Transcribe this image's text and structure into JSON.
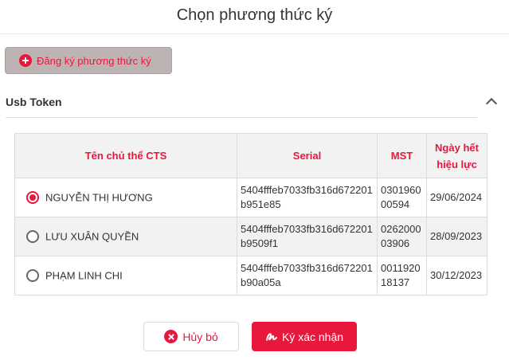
{
  "dialog": {
    "title": "Chọn phương thức ký"
  },
  "register_button": {
    "label": "Đăng ký phương thức ký",
    "icon": "plus-circle-icon"
  },
  "section": {
    "title": "Usb Token",
    "toggle_icon": "chevron-up-icon"
  },
  "table": {
    "headers": [
      "Tên chủ thể CTS",
      "Serial",
      "MST",
      "Ngày hết hiệu lực"
    ],
    "rows": [
      {
        "name": "NGUYỄN THỊ HƯƠNG",
        "serial": "5404fffeb7033fb316d672201b951e85",
        "mst": "030196000594",
        "expiry": "29/06/2024",
        "selected": true
      },
      {
        "name": "LƯU XUÂN QUYỀN",
        "serial": "5404fffeb7033fb316d672201b9509f1",
        "mst": "026200003906",
        "expiry": "28/09/2023",
        "selected": false
      },
      {
        "name": "PHẠM LINH CHI",
        "serial": "5404fffeb7033fb316d672201b90a05a",
        "mst": "001192018137",
        "expiry": "30/12/2023",
        "selected": false
      }
    ]
  },
  "footer": {
    "cancel_label": "Hủy bỏ",
    "cancel_icon": "close-circle-icon",
    "confirm_label": "Ký xác nhận",
    "confirm_icon": "signature-icon"
  },
  "colors": {
    "accent": "#e8173c",
    "header_bg": "#f2f2f2",
    "register_bg": "#bdb3b3"
  }
}
